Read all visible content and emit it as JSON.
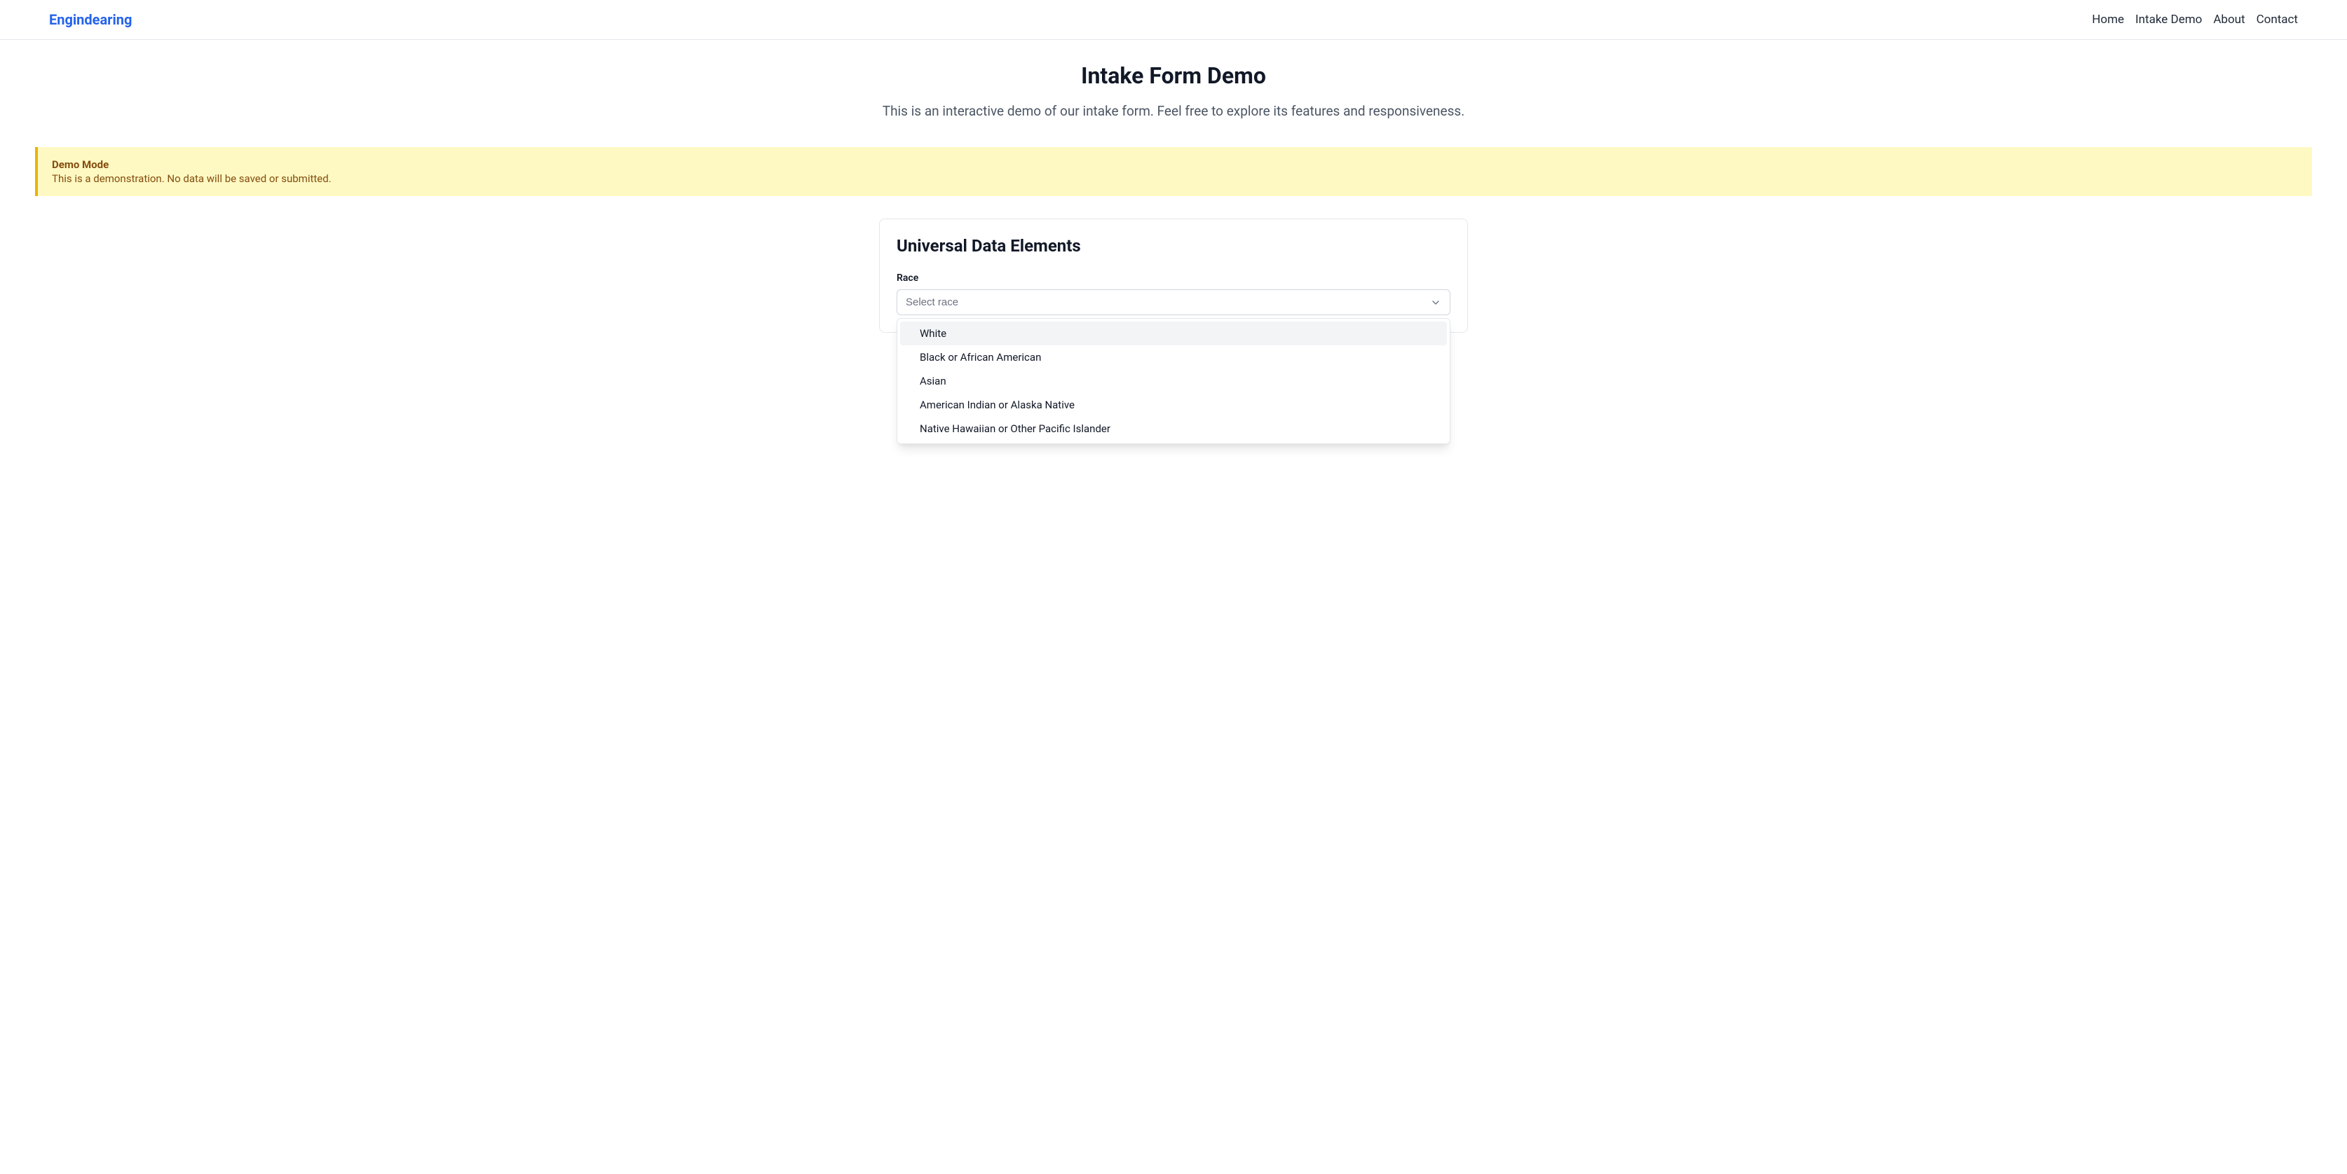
{
  "header": {
    "logo": "Engindearing",
    "nav": {
      "home": "Home",
      "intake_demo": "Intake Demo",
      "about": "About",
      "contact": "Contact"
    }
  },
  "page": {
    "title": "Intake Form Demo",
    "subtitle": "This is an interactive demo of our intake form. Feel free to explore its features and responsiveness."
  },
  "alert": {
    "title": "Demo Mode",
    "text": "This is a demonstration. No data will be saved or submitted."
  },
  "card": {
    "title": "Universal Data Elements",
    "race_field": {
      "label": "Race",
      "placeholder": "Select race",
      "options": [
        "White",
        "Black or African American",
        "Asian",
        "American Indian or Alaska Native",
        "Native Hawaiian or Other Pacific Islander"
      ]
    }
  }
}
